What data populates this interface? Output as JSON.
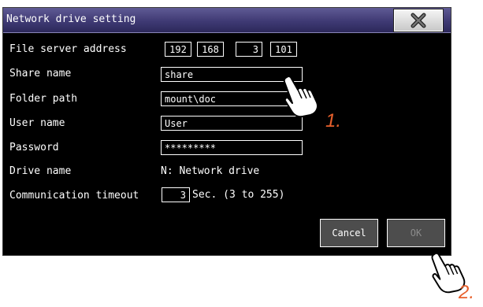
{
  "window": {
    "title": "Network drive setting",
    "close_icon": "close-x-icon"
  },
  "form": {
    "file_server_address": {
      "label": "File server address",
      "octets": [
        "192",
        "168",
        "3",
        "101"
      ]
    },
    "share_name": {
      "label": "Share name",
      "value": "share"
    },
    "folder_path": {
      "label": "Folder path",
      "value": "mount\\doc"
    },
    "user_name": {
      "label": "User name",
      "value": "User"
    },
    "password": {
      "label": "Password",
      "value": "*********"
    },
    "drive_name": {
      "label": "Drive name",
      "value": "N: Network drive"
    },
    "communication_timeout": {
      "label": "Communication timeout",
      "value": "3",
      "unit_hint": "Sec. (3 to 255)"
    }
  },
  "buttons": {
    "cancel_label": "Cancel",
    "ok_label": "OK"
  },
  "annotations": {
    "step1": "1.",
    "step2": "2.",
    "hand_icon": "pointing-hand-icon",
    "accent_color": "#e8602c"
  }
}
